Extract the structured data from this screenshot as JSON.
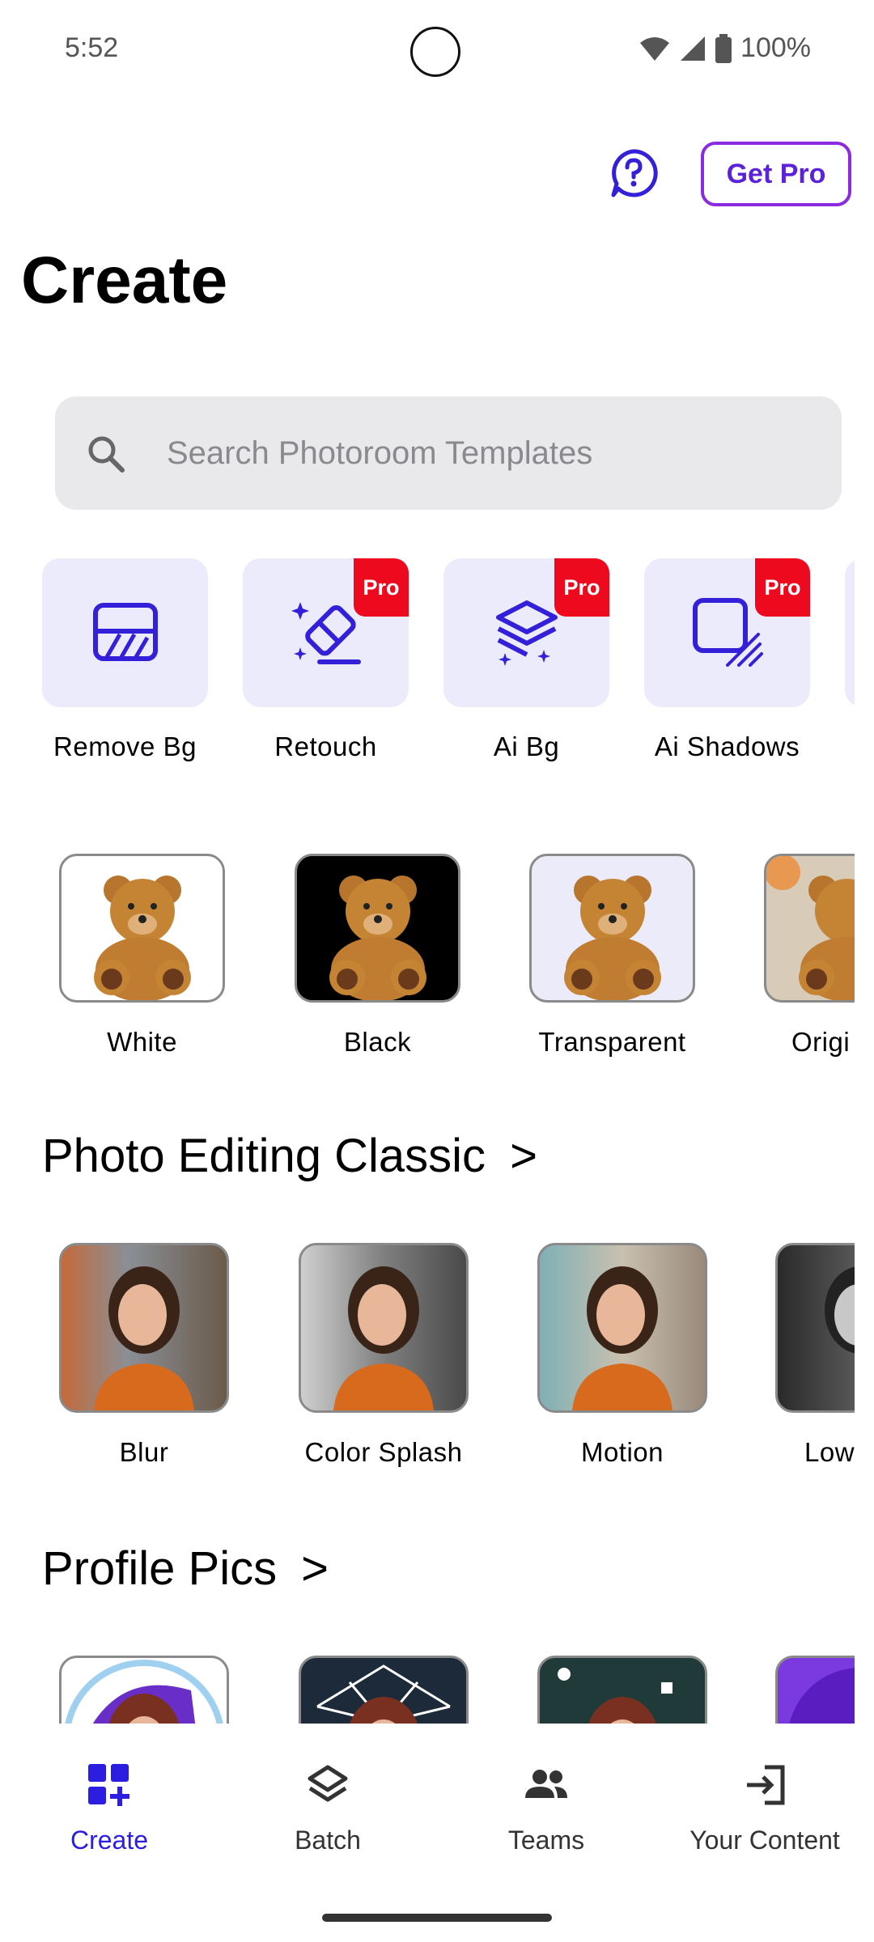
{
  "status_bar": {
    "time": "5:52",
    "battery": "100%"
  },
  "header": {
    "get_pro_label": "Get Pro",
    "title": "Create"
  },
  "search": {
    "placeholder": "Search Photoroom Templates"
  },
  "tools": [
    {
      "label": "Remove Bg",
      "pro": false,
      "icon": "remove-bg-icon"
    },
    {
      "label": "Retouch",
      "pro": true,
      "icon": "eraser-sparkle-icon"
    },
    {
      "label": "Ai Bg",
      "pro": true,
      "icon": "layers-sparkle-icon"
    },
    {
      "label": "Ai Shadows",
      "pro": true,
      "icon": "shadow-square-icon"
    }
  ],
  "pro_badge": "Pro",
  "backgrounds": [
    {
      "label": "White"
    },
    {
      "label": "Black"
    },
    {
      "label": "Transparent"
    },
    {
      "label": "Origi"
    }
  ],
  "sections": [
    {
      "title": "Photo Editing Classic",
      "chevron": ">",
      "items": [
        "Blur",
        "Color Splash",
        "Motion",
        "Low"
      ]
    },
    {
      "title": "Profile Pics",
      "chevron": ">",
      "items": []
    }
  ],
  "bottom_nav": [
    {
      "label": "Create",
      "active": true,
      "icon": "create-grid-icon"
    },
    {
      "label": "Batch",
      "active": false,
      "icon": "layers-icon"
    },
    {
      "label": "Teams",
      "active": false,
      "icon": "people-icon"
    },
    {
      "label": "Your Content",
      "active": false,
      "icon": "login-arrow-icon"
    }
  ],
  "colors": {
    "accent": "#2b1ee0",
    "pro_badge": "#ee0a1e",
    "tile_bg": "#ecebfc",
    "get_pro_border": "#8a2be2"
  }
}
